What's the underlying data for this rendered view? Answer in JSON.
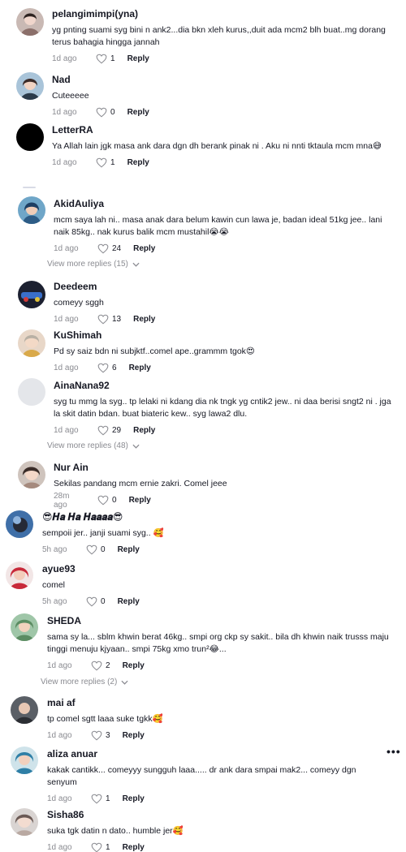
{
  "comments": [
    {
      "username": "pelangimimpi(yna)",
      "text": "yg pnting suami syg bini n ank2...dia bkn xleh kurus,,duit ada mcm2 blh buat..mg dorang terus bahagia hingga jannah",
      "time": "1d ago",
      "likes": "1",
      "reply_label": "Reply",
      "avatar_icon": "user-avatar-icon"
    },
    {
      "username": "Nad",
      "text": "Cuteeeee",
      "time": "1d ago",
      "likes": "0",
      "reply_label": "Reply",
      "avatar_icon": "user-avatar-icon"
    },
    {
      "username": "LetterRA",
      "text": "Ya Allah lain jgk masa ank dara dgn dh berank pinak ni . Aku ni nnti tktaula mcm mna😅",
      "time": "1d ago",
      "likes": "1",
      "reply_label": "Reply",
      "avatar_icon": "user-avatar-icon"
    },
    {
      "username": "AkidAuliya",
      "text": "mcm saya lah ni.. masa anak dara belum kawin cun lawa je, badan ideal 51kg jee.. lani naik 85kg.. nak kurus balik mcm mustahil😭😭",
      "time": "1d ago",
      "likes": "24",
      "reply_label": "Reply",
      "avatar_icon": "user-avatar-icon"
    },
    {
      "username": "Deedeem",
      "text": "comeyy sggh",
      "time": "1d ago",
      "likes": "13",
      "reply_label": "Reply",
      "avatar_icon": "user-avatar-icon"
    },
    {
      "username": "KuShimah",
      "text": "Pd sy saiz bdn ni subjktf..comel ape..grammm tgok😍",
      "time": "1d ago",
      "likes": "6",
      "reply_label": "Reply",
      "avatar_icon": "user-avatar-icon"
    },
    {
      "username": "AinaNana92",
      "text": "syg tu mmg la syg.. tp lelaki ni kdang dia nk tngk yg cntik2 jew.. ni daa berisi sngt2 ni . jga la skit datin bdan. buat biateric kew.. syg lawa2 dlu.",
      "time": "1d ago",
      "likes": "29",
      "reply_label": "Reply",
      "avatar_icon": "user-avatar-icon"
    },
    {
      "username": "Nur Ain",
      "text": "Sekilas pandang mcm ernie zakri. Comel jeee",
      "time": "28m ago",
      "likes": "0",
      "reply_label": "Reply",
      "avatar_icon": "user-avatar-icon"
    },
    {
      "username": "😎𝑯𝒂 𝑯𝒂 𝑯𝒂𝒂𝒂𝒂😎",
      "text": "sempoii jer.. janji suami syg.. 🥰",
      "time": "5h ago",
      "likes": "0",
      "reply_label": "Reply",
      "avatar_icon": "user-avatar-icon"
    },
    {
      "username": "ayue93",
      "text": "comel",
      "time": "5h ago",
      "likes": "0",
      "reply_label": "Reply",
      "avatar_icon": "user-avatar-icon"
    },
    {
      "username": "SHEDA",
      "text": "sama sy la... sblm khwin berat 46kg.. smpi org ckp sy sakit.. bila dh khwin naik trusss maju tinggi menuju kjyaan.. smpi 75kg xmo trun²😂...",
      "time": "1d ago",
      "likes": "2",
      "reply_label": "Reply",
      "avatar_icon": "user-avatar-icon"
    },
    {
      "username": "mai af",
      "text": "tp comel sgtt laaa suke tgkk🥰",
      "time": "1d ago",
      "likes": "3",
      "reply_label": "Reply",
      "avatar_icon": "user-avatar-icon"
    },
    {
      "username": "aliza anuar",
      "text": "kakak cantikk... comeyyy sungguh laaa..... dr ank dara smpai mak2... comeyy dgn senyum",
      "time": "1d ago",
      "likes": "1",
      "reply_label": "Reply",
      "avatar_icon": "user-avatar-icon"
    },
    {
      "username": "Sisha86",
      "text": "suka tgk datin n dato.. humble jer🥰",
      "time": "1d ago",
      "likes": "1",
      "reply_label": "Reply",
      "avatar_icon": "user-avatar-icon"
    }
  ],
  "view_more": {
    "akid": "View more replies (15)",
    "aina": "View more replies (48)",
    "sheda": "View more replies (2)"
  },
  "more_options": "•••",
  "icons": {
    "like": "heart-icon",
    "chevron": "chevron-down-icon",
    "more": "more-options-icon"
  },
  "colors": {
    "text": "#161823",
    "muted": "#8a8b91",
    "background": "#ffffff"
  }
}
